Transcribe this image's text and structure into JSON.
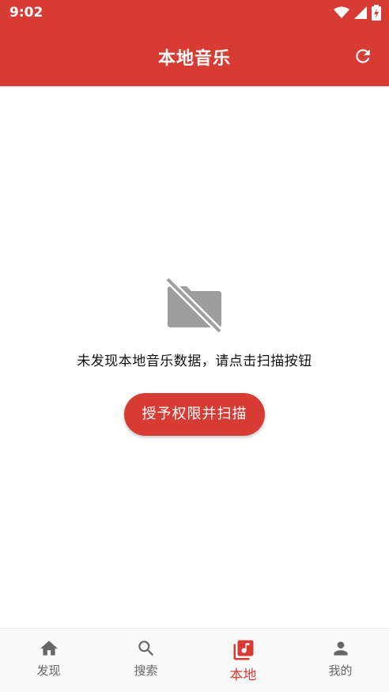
{
  "status_bar": {
    "time": "9:02"
  },
  "app_bar": {
    "title": "本地音乐"
  },
  "empty_state": {
    "message": "未发现本地音乐数据，请点击扫描按钮",
    "button_label": "授予权限并扫描"
  },
  "bottom_nav": {
    "items": [
      {
        "label": "发现",
        "icon": "home-icon"
      },
      {
        "label": "搜索",
        "icon": "search-icon"
      },
      {
        "label": "本地",
        "icon": "library-music-icon",
        "active": true
      },
      {
        "label": "我的",
        "icon": "person-icon"
      }
    ]
  },
  "colors": {
    "primary": "#d63c34",
    "inactive": "#666666"
  }
}
